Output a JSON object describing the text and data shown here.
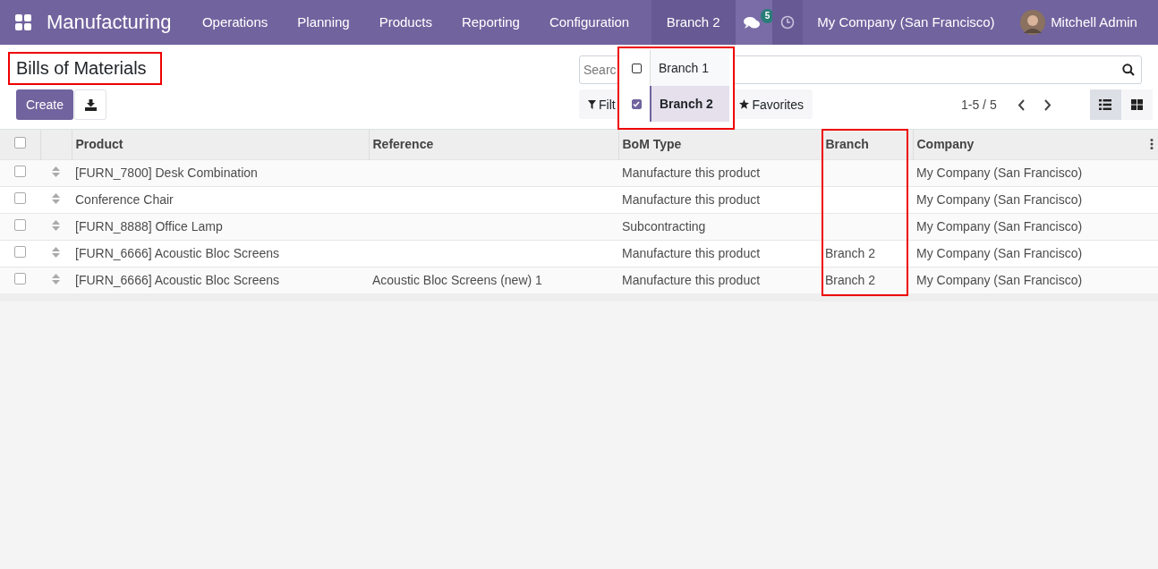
{
  "navbar": {
    "app_name": "Manufacturing",
    "menu": [
      "Operations",
      "Planning",
      "Products",
      "Reporting",
      "Configuration"
    ],
    "branch_switch": "Branch 2",
    "messages_count": "5",
    "company": "My Company (San Francisco)",
    "user": "Mitchell Admin"
  },
  "branch_dropdown": {
    "items": [
      {
        "label": "Branch 1",
        "checked": false
      },
      {
        "label": "Branch 2",
        "checked": true
      }
    ]
  },
  "control_panel": {
    "title": "Bills of Materials",
    "create_button": "Create",
    "search": {
      "placeholder": "Searc"
    },
    "filter_buttons": [
      "Filt",
      "Favorites"
    ],
    "pager": "1-5 / 5",
    "views": [
      {
        "kind": "list",
        "selected": true
      },
      {
        "kind": "kanban",
        "selected": false
      }
    ]
  },
  "table": {
    "select_all_checked": false,
    "columns": [
      "Product",
      "Reference",
      "BoM Type",
      "Branch",
      "Company"
    ],
    "rows": [
      {
        "checked": false,
        "cells": [
          "[FURN_7800] Desk Combination",
          "",
          "Manufacture this product",
          "",
          "My Company (San Francisco)"
        ]
      },
      {
        "checked": false,
        "cells": [
          "Conference Chair",
          "",
          "Manufacture this product",
          "",
          "My Company (San Francisco)"
        ]
      },
      {
        "checked": false,
        "cells": [
          "[FURN_8888] Office Lamp",
          "",
          "Subcontracting",
          "",
          "My Company (San Francisco)"
        ]
      },
      {
        "checked": false,
        "cells": [
          "[FURN_6666] Acoustic Bloc Screens",
          "",
          "Manufacture this product",
          "Branch 2",
          "My Company (San Francisco)"
        ]
      },
      {
        "checked": false,
        "cells": [
          "[FURN_6666] Acoustic Bloc Screens",
          "Acoustic Bloc Screens (new) 1",
          "Manufacture this product",
          "Branch 2",
          "My Company (San Francisco)"
        ]
      }
    ]
  }
}
